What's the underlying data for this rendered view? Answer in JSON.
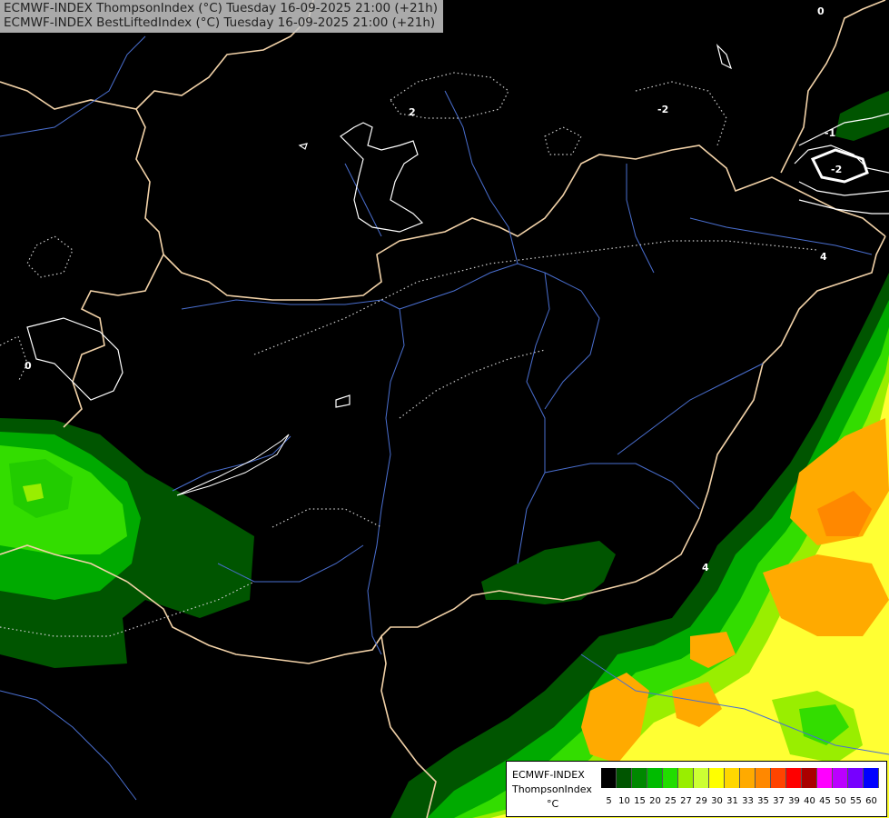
{
  "header": {
    "line1": "ECMWF-INDEX ThompsonIndex (°C) Tuesday 16-09-2025 21:00 (+21h)",
    "line2": "ECMWF-INDEX BestLiftedIndex (°C) Tuesday 16-09-2025 21:00 (+21h)"
  },
  "legend": {
    "model": "ECMWF-INDEX",
    "parameter": "ThompsonIndex",
    "unit": "°C",
    "colors": [
      "#000000",
      "#000000",
      "#000000",
      "#000000",
      "#005500",
      "#008800",
      "#00bb00",
      "#22dd00",
      "#99ee00",
      "#ccff33",
      "#ffff00",
      "#ffd700",
      "#ffaa00",
      "#ff8800",
      "#ff4400",
      "#ff0000",
      "#aa0000",
      "#ff00ff",
      "#bb00ff",
      "#7700ff",
      "#0000ff"
    ],
    "ticks": [
      "5",
      "10",
      "15",
      "20",
      "25",
      "27",
      "29",
      "30",
      "31",
      "33",
      "35",
      "37",
      "39",
      "40",
      "45",
      "50",
      "55",
      "60"
    ]
  },
  "contour_labels": [
    {
      "text": "0"
    },
    {
      "text": "2"
    },
    {
      "text": "-2"
    },
    {
      "text": "-1"
    },
    {
      "text": "-2"
    },
    {
      "text": "0"
    },
    {
      "text": "4"
    },
    {
      "text": "4"
    }
  ],
  "colors": {
    "border": "#f2d2a8",
    "river": "#4a6fd0",
    "contour": "#ffffff",
    "dark_green": "#005500",
    "green": "#00aa00",
    "bright_green": "#33dd00",
    "lime": "#99ee00",
    "yellow": "#ffff33",
    "orange": "#ffaa00"
  }
}
